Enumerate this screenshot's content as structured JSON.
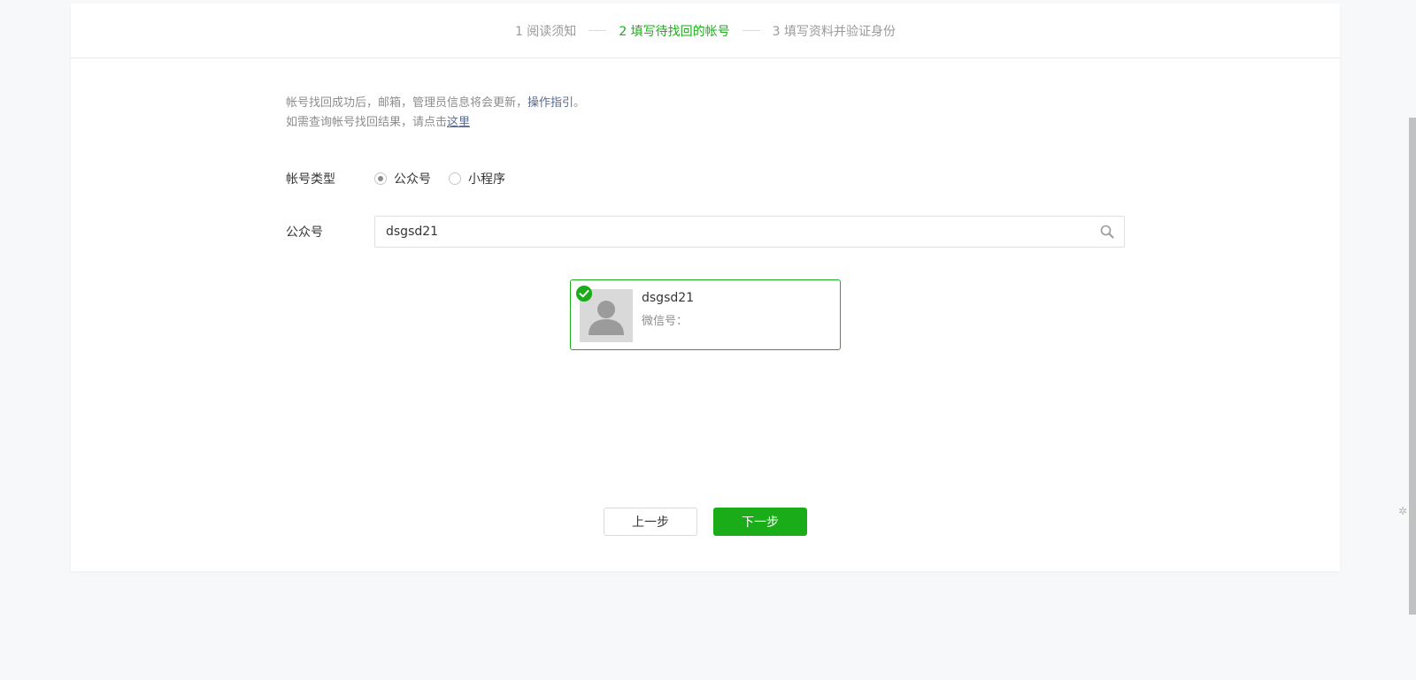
{
  "steps": [
    {
      "label": "1 阅读须知"
    },
    {
      "label": "2 填写待找回的帐号"
    },
    {
      "label": "3 填写资料并验证身份"
    }
  ],
  "notice": {
    "line1_prefix": "帐号找回成功后，邮箱，管理员信息将会更新，",
    "line1_link": "操作指引",
    "line1_suffix": "。",
    "line2_prefix": "如需查询帐号找回结果，请点击",
    "line2_link": "这里"
  },
  "account_type": {
    "label": "帐号类型",
    "options": [
      {
        "label": "公众号",
        "checked": true
      },
      {
        "label": "小程序",
        "checked": false
      }
    ]
  },
  "search": {
    "label": "公众号",
    "value": "dsgsd21",
    "icon": "search-icon"
  },
  "result": {
    "name": "dsgsd21",
    "wechat_id_label": "微信号：",
    "selected": true
  },
  "buttons": {
    "prev_label": "上一步",
    "next_label": "下一步"
  },
  "colors": {
    "accent": "#1aad19",
    "link": "#576b95"
  }
}
